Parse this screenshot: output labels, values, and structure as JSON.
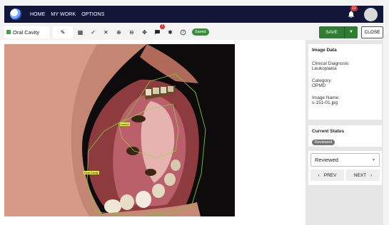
{
  "nav": {
    "links": [
      "HOME",
      "MY WORK",
      "OPTIONS"
    ],
    "notification_count": "13"
  },
  "toolbar": {
    "category_label": "Oral Cavity",
    "category_color": "#43a047",
    "tools": [
      {
        "icon": "table-icon",
        "glyph": "▦"
      },
      {
        "icon": "check-icon",
        "glyph": "✓"
      },
      {
        "icon": "close-icon",
        "glyph": "✕"
      },
      {
        "icon": "zoom-in-icon",
        "glyph": "⊕"
      },
      {
        "icon": "zoom-out-icon",
        "glyph": "⊖"
      },
      {
        "icon": "move-icon",
        "glyph": "✥"
      },
      {
        "icon": "comment-icon",
        "glyph": "▰",
        "badge": "1"
      },
      {
        "icon": "settings-icon",
        "glyph": "✱"
      },
      {
        "icon": "help-icon",
        "glyph": "?"
      }
    ],
    "saved_label": "Saved",
    "save_label": "SAVE",
    "close_label": "CLOSE"
  },
  "annotations": [
    {
      "label": "Lesion"
    },
    {
      "label": "Oral Cavity"
    }
  ],
  "image_data": {
    "title": "Image Data",
    "diagnosis_label": "Clinical Diagnosis:",
    "diagnosis_value": "Leukoplakia",
    "category_label": "Category:",
    "category_value": "OPMD",
    "image_name_label": "Image Name:",
    "image_name_value": "s-151-01.jpg"
  },
  "status": {
    "title": "Current Status",
    "value": "Reviewed"
  },
  "review": {
    "selected": "Reviewed",
    "prev_label": "PREV",
    "next_label": "NEXT"
  }
}
